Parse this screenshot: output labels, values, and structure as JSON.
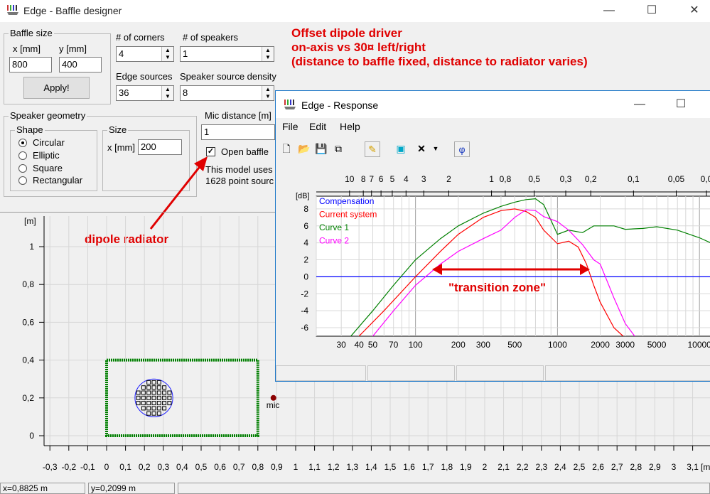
{
  "main": {
    "title": "Edge - Baffle designer",
    "baffle_size": {
      "legend": "Baffle size",
      "x_label": "x [mm]",
      "y_label": "y [mm]",
      "x_value": "800",
      "y_value": "400",
      "apply_label": "Apply!"
    },
    "corners": {
      "label": "# of corners",
      "value": "4"
    },
    "speakers": {
      "label": "# of speakers",
      "value": "1"
    },
    "edge_sources": {
      "label": "Edge sources",
      "value": "36"
    },
    "speaker_density": {
      "label": "Speaker source density",
      "value": "8"
    },
    "geometry": {
      "legend": "Speaker geometry",
      "shape_legend": "Shape",
      "shapes": [
        "Circular",
        "Elliptic",
        "Square",
        "Rectangular"
      ],
      "selected_shape": "Circular",
      "size_legend": "Size",
      "size_label": "x [mm]",
      "size_value": "200"
    },
    "mic_distance": {
      "label": "Mic distance [m]",
      "value": "1"
    },
    "open_baffle": {
      "label": "Open baffle",
      "checked": true
    },
    "model_info": [
      "This model uses",
      "1628 point sourc"
    ],
    "status": {
      "x": "x=0,8825 m",
      "y": "y=0,2099 m"
    },
    "plot": {
      "unit_label": "[m]",
      "mic_label": "mic",
      "y_ticks": [
        "1",
        "0,8",
        "0,6",
        "0,4",
        "0,2",
        "0"
      ],
      "x_ticks": [
        "-0,3",
        "-0,2",
        "-0,1",
        "0",
        "0,1",
        "0,2",
        "0,3",
        "0,4",
        "0,5",
        "0,6",
        "0,7",
        "0,8",
        "0,9",
        "1",
        "1,1",
        "1,2",
        "1,3",
        "1,4",
        "1,5",
        "1,6",
        "1,7",
        "1,8",
        "1,9",
        "2",
        "2,1",
        "2,2",
        "2,3",
        "2,4",
        "2,5",
        "2,6",
        "2,7",
        "2,8",
        "2,9",
        "3",
        "3,1"
      ],
      "x_unit": "[m"
    }
  },
  "annotations": {
    "heading": [
      "Offset dipole driver",
      "on-axis vs 30¤ left/right",
      "(distance to baffle fixed, distance to radiator varies)"
    ],
    "dipole_radiator": "dipole radiator",
    "transition_zone": "\"transition zone\""
  },
  "response": {
    "title": "Edge - Response",
    "menu": [
      "File",
      "Edit",
      "Help"
    ],
    "toolbar_icons": [
      "new-icon",
      "open-icon",
      "save-icon",
      "copy-icon",
      "pen-icon",
      "cube-icon",
      "delete-icon",
      "dropdown-icon",
      "phi-icon"
    ],
    "chart_data": {
      "type": "line",
      "ylabel": "[dB]",
      "y_ticks": [
        "8",
        "6",
        "4",
        "2",
        "0",
        "-2",
        "-4",
        "-6"
      ],
      "x_ticks": [
        "30",
        "40",
        "50",
        "70",
        "100",
        "200",
        "300",
        "500",
        "1000",
        "2000",
        "3000",
        "5000",
        "10000"
      ],
      "top_ticks": [
        "10",
        "8",
        "7",
        "6",
        "5",
        "4",
        "3",
        "2",
        "1",
        "0,8",
        "0,5",
        "0,3",
        "0,2",
        "0,1",
        "0,05",
        "0,0"
      ],
      "ylim": [
        -7,
        9.5
      ],
      "xlim": [
        20,
        12000
      ],
      "grid": true,
      "legend_position": "top-left",
      "series": [
        {
          "name": "Compensation",
          "color": "#0000ff",
          "x": [
            20,
            12000
          ],
          "y": [
            0,
            0
          ]
        },
        {
          "name": "Current system",
          "color": "#ff0000",
          "x": [
            40,
            60,
            100,
            150,
            200,
            300,
            400,
            500,
            600,
            700,
            800,
            1000,
            1200,
            1400,
            1600,
            1800,
            2000,
            2500,
            2900
          ],
          "y": [
            -7,
            -4,
            0,
            3,
            5,
            7,
            7.8,
            8,
            7.7,
            7,
            5.5,
            3.9,
            4.2,
            3.5,
            1.5,
            -1,
            -3,
            -6,
            -7
          ]
        },
        {
          "name": "Curve 1",
          "color": "#008000",
          "x": [
            35,
            50,
            70,
            100,
            150,
            200,
            300,
            400,
            500,
            600,
            700,
            800,
            1000,
            1200,
            1500,
            1800,
            2000,
            2500,
            3000,
            4000,
            5000,
            7000,
            10000,
            12000
          ],
          "y": [
            -7,
            -4,
            -1,
            2,
            4.5,
            6,
            7.5,
            8.3,
            8.8,
            9.1,
            9.2,
            8.5,
            5,
            5.5,
            5.2,
            6,
            6,
            6,
            5.6,
            5.7,
            5.9,
            5.5,
            4.6,
            4
          ],
          "range_label": "Curve 1"
        },
        {
          "name": "Curve 2",
          "color": "#ff00ff",
          "x": [
            50,
            70,
            100,
            150,
            200,
            300,
            400,
            500,
            600,
            700,
            800,
            1000,
            1200,
            1500,
            1800,
            2000,
            2500,
            3000,
            3500
          ],
          "y": [
            -7,
            -4,
            -1,
            1.5,
            3,
            4.5,
            5.5,
            7,
            7.9,
            7.8,
            7.1,
            6.5,
            5.5,
            3.8,
            2,
            1.5,
            -2.5,
            -5.5,
            -7
          ]
        }
      ]
    }
  }
}
